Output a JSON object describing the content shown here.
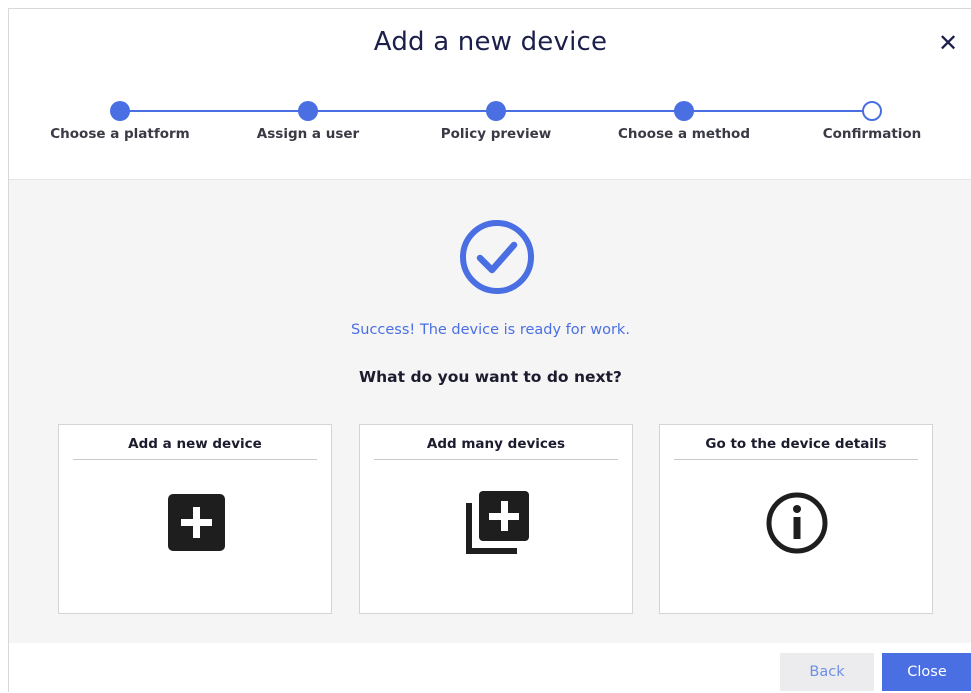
{
  "dialog": {
    "title": "Add a new device",
    "close_icon": "close-icon"
  },
  "stepper": {
    "steps": [
      {
        "label": "Choose a platform",
        "state": "done"
      },
      {
        "label": "Assign a user",
        "state": "done"
      },
      {
        "label": "Policy preview",
        "state": "done"
      },
      {
        "label": "Choose a method",
        "state": "done"
      },
      {
        "label": "Confirmation",
        "state": "current"
      }
    ]
  },
  "result": {
    "icon": "check-circle-icon",
    "message": "Success! The device is ready for work.",
    "question": "What do you want to do next?"
  },
  "options": [
    {
      "title": "Add a new device",
      "icon": "plus-square-icon"
    },
    {
      "title": "Add many devices",
      "icon": "plus-stack-icon"
    },
    {
      "title": "Go to the device details",
      "icon": "info-circle-icon"
    }
  ],
  "footer": {
    "back_label": "Back",
    "close_label": "Close"
  },
  "colors": {
    "accent": "#4a6fe3",
    "title_text": "#1b1f4a",
    "body_background": "#f5f5f6",
    "disabled_button_background": "#ececee"
  }
}
